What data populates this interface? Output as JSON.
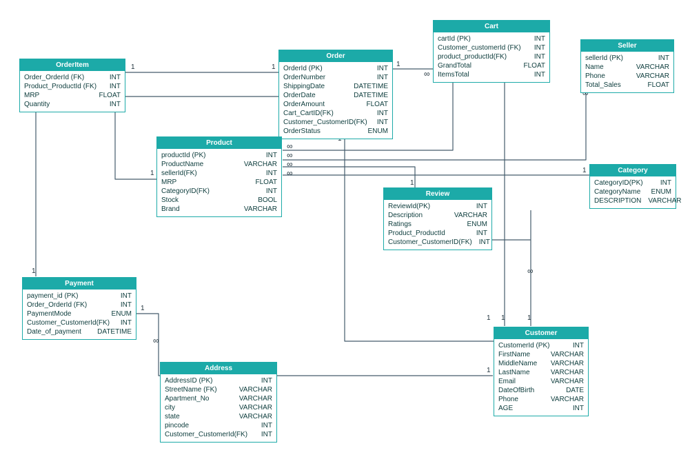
{
  "colors": {
    "header": "#1CAAA8",
    "line": "#435B6B"
  },
  "entities": {
    "orderItem": {
      "title": "OrderItem",
      "fields": [
        {
          "name": "Order_OrderId (FK)",
          "type": "INT"
        },
        {
          "name": "Product_ProductId (FK)",
          "type": "INT"
        },
        {
          "name": "MRP",
          "type": "FLOAT"
        },
        {
          "name": "Quantity",
          "type": "INT"
        }
      ]
    },
    "order": {
      "title": "Order",
      "fields": [
        {
          "name": "OrderId (PK)",
          "type": "INT"
        },
        {
          "name": "OrderNumber",
          "type": "INT"
        },
        {
          "name": "ShippingDate",
          "type": "DATETIME"
        },
        {
          "name": "OrderDate",
          "type": "DATETIME"
        },
        {
          "name": "OrderAmount",
          "type": "FLOAT"
        },
        {
          "name": "Cart_CartID(FK)",
          "type": "INT"
        },
        {
          "name": "Customer_CustomerID(FK)",
          "type": "INT"
        },
        {
          "name": "OrderStatus",
          "type": "ENUM"
        }
      ]
    },
    "cart": {
      "title": "Cart",
      "fields": [
        {
          "name": "cartId (PK)",
          "type": "INT"
        },
        {
          "name": "Customer_customerId (FK)",
          "type": "INT"
        },
        {
          "name": "product_productId(FK)",
          "type": "INT"
        },
        {
          "name": "GrandTotal",
          "type": "FLOAT"
        },
        {
          "name": "ItemsTotal",
          "type": "INT"
        }
      ]
    },
    "seller": {
      "title": "Seller",
      "fields": [
        {
          "name": "sellerId (PK)",
          "type": "INT"
        },
        {
          "name": "Name",
          "type": "VARCHAR"
        },
        {
          "name": "Phone",
          "type": "VARCHAR"
        },
        {
          "name": "Total_Sales",
          "type": "FLOAT"
        }
      ]
    },
    "product": {
      "title": "Product",
      "fields": [
        {
          "name": "productId (PK)",
          "type": "INT"
        },
        {
          "name": "ProductName",
          "type": "VARCHAR"
        },
        {
          "name": "sellerId(FK)",
          "type": "INT"
        },
        {
          "name": "MRP",
          "type": "FLOAT"
        },
        {
          "name": "CategoryID(FK)",
          "type": "INT"
        },
        {
          "name": "Stock",
          "type": "BOOL"
        },
        {
          "name": "Brand",
          "type": "VARCHAR"
        }
      ]
    },
    "review": {
      "title": "Review",
      "fields": [
        {
          "name": "ReviewId(PK)",
          "type": "INT"
        },
        {
          "name": "Description",
          "type": "VARCHAR"
        },
        {
          "name": "Ratings",
          "type": "ENUM"
        },
        {
          "name": "Product_ProductId",
          "type": "INT"
        },
        {
          "name": "Customer_CustomerID(FK)",
          "type": "INT"
        }
      ]
    },
    "category": {
      "title": "Category",
      "fields": [
        {
          "name": "CategoryID(PK)",
          "type": "INT"
        },
        {
          "name": "CategoryName",
          "type": "ENUM"
        },
        {
          "name": "DESCRIPTION",
          "type": "VARCHAR"
        }
      ]
    },
    "payment": {
      "title": "Payment",
      "fields": [
        {
          "name": "payment_id (PK)",
          "type": "INT"
        },
        {
          "name": "Order_OrderId (FK)",
          "type": "INT"
        },
        {
          "name": "PaymentMode",
          "type": "ENUM"
        },
        {
          "name": "Customer_CustomerId(FK)",
          "type": "INT"
        },
        {
          "name": "Date_of_payment",
          "type": "DATETIME"
        }
      ]
    },
    "address": {
      "title": "Address",
      "fields": [
        {
          "name": "AddressID (PK)",
          "type": "INT"
        },
        {
          "name": "StreetName (FK)",
          "type": "VARCHAR"
        },
        {
          "name": "Apartment_No",
          "type": "VARCHAR"
        },
        {
          "name": "city",
          "type": "VARCHAR"
        },
        {
          "name": "state",
          "type": "VARCHAR"
        },
        {
          "name": "pincode",
          "type": "INT"
        },
        {
          "name": "Customer_CustomerId(FK)",
          "type": "INT"
        }
      ]
    },
    "customer": {
      "title": "Customer",
      "fields": [
        {
          "name": "CustomerId (PK)",
          "type": "INT"
        },
        {
          "name": "FirstName",
          "type": "VARCHAR"
        },
        {
          "name": "MiddleName",
          "type": "VARCHAR"
        },
        {
          "name": "LastName",
          "type": "VARCHAR"
        },
        {
          "name": "Email",
          "type": "VARCHAR"
        },
        {
          "name": "DateOfBirth",
          "type": "DATE"
        },
        {
          "name": "Phone",
          "type": "VARCHAR"
        },
        {
          "name": "AGE",
          "type": "INT"
        }
      ]
    }
  },
  "labels": {
    "one": "1",
    "inf": "∞"
  }
}
